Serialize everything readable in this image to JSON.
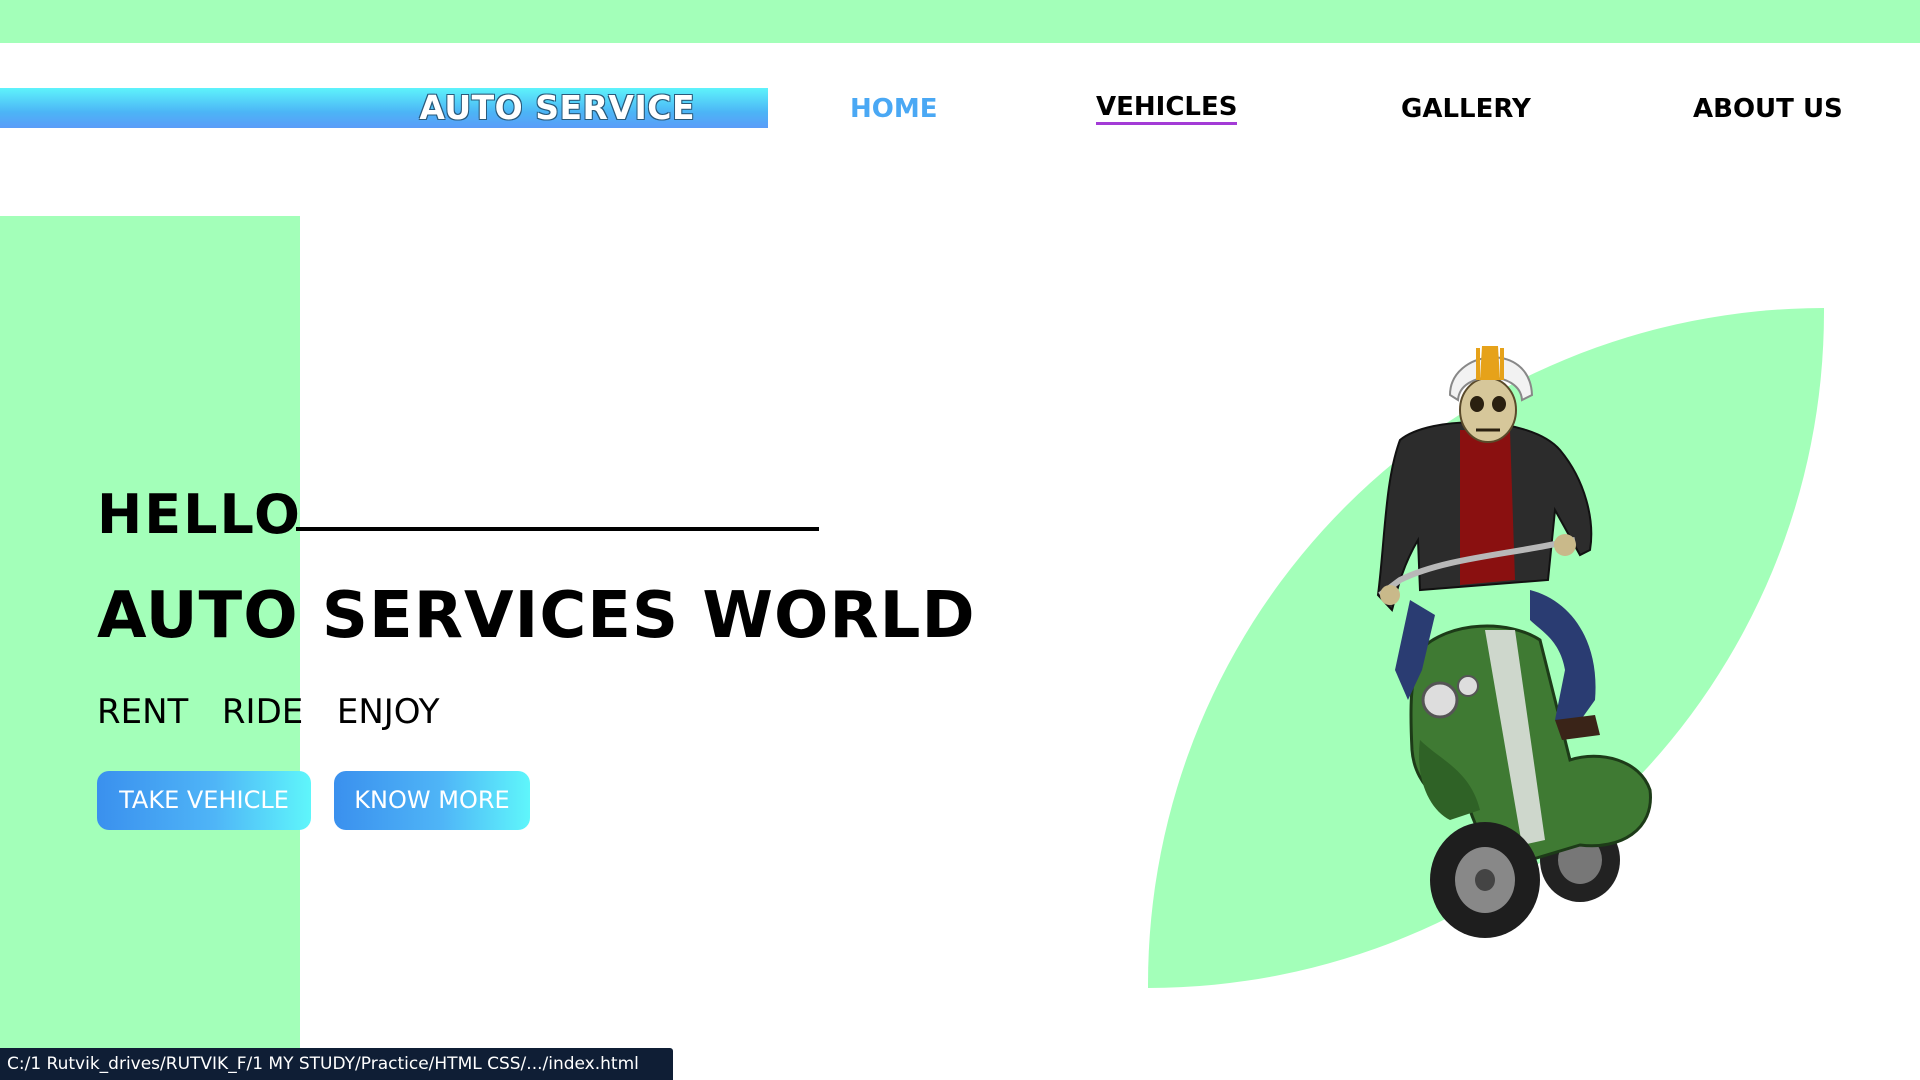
{
  "header": {
    "logo_text": "AUTO SERVICE",
    "nav": {
      "home": "HOME",
      "vehicles": "VEHICLES",
      "gallery": "GALLERY",
      "about": "ABOUT US"
    }
  },
  "hero": {
    "hello": "HELLO",
    "title": "AUTO SERVICES WORLD",
    "tagline": "RENT  RIDE  ENJOY",
    "buttons": {
      "take_vehicle": "TAKE VEHICLE",
      "know_more": "KNOW MORE"
    },
    "illustration_icon": "skeleton-rider-on-scooter"
  },
  "status_bar": {
    "url": "C:/1 Rutvik_drives/RUTVIK_F/1 MY STUDY/Practice/HTML CSS/.../index.html"
  },
  "colors": {
    "accent_green": "#a3ffb9",
    "nav_active_blue": "#4aa8f4",
    "nav_underline_purple": "#a33bd6",
    "button_gradient_start": "#3a90ee",
    "button_gradient_end": "#5ff6fb",
    "status_bar_bg": "#0f1e35"
  }
}
